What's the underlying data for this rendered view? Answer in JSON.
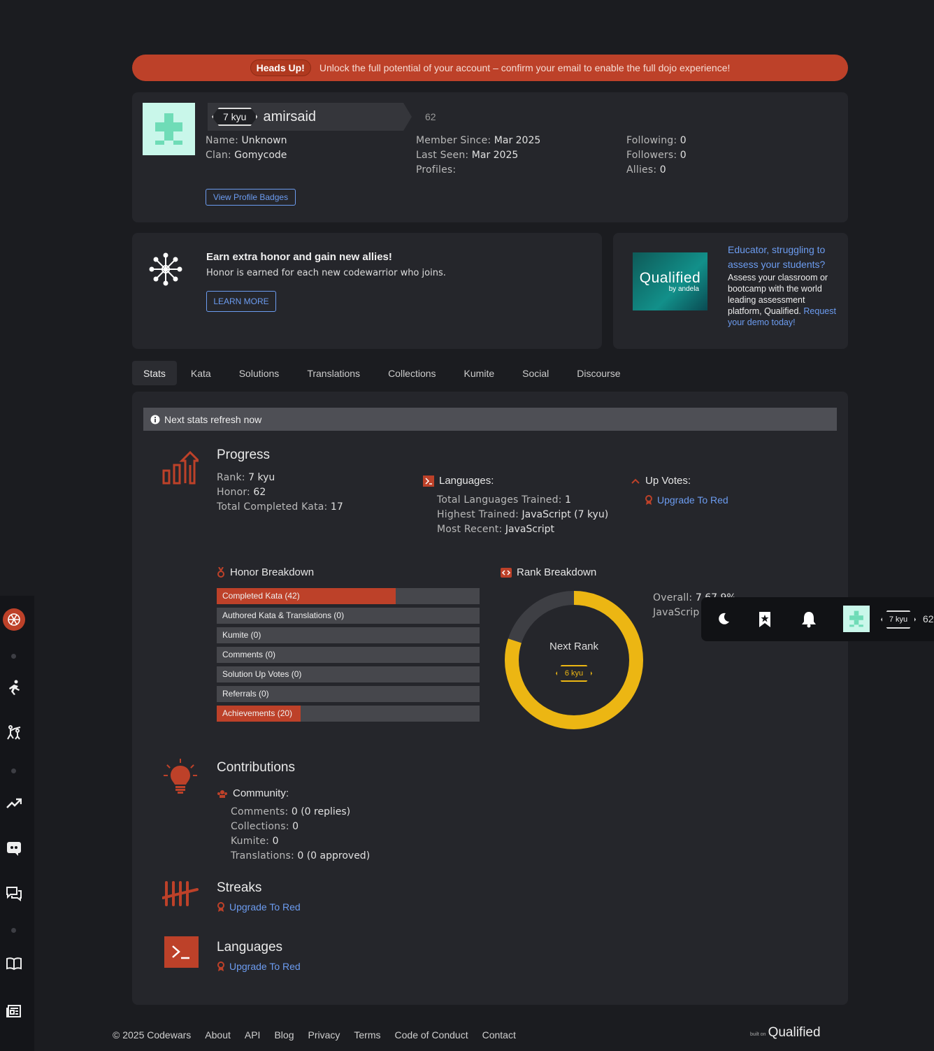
{
  "banner": {
    "pill": "Heads Up!",
    "message": "Unlock the full potential of your account – confirm your email to enable the full dojo experience!"
  },
  "profile": {
    "rank": "7 kyu",
    "username": "amirsaid",
    "honor": "62",
    "name_label": "Name:",
    "name": "Unknown",
    "clan_label": "Clan:",
    "clan": "Gomycode",
    "member_since_label": "Member Since:",
    "member_since": "Mar 2025",
    "last_seen_label": "Last Seen:",
    "last_seen": "Mar 2025",
    "profiles_label": "Profiles:",
    "following_label": "Following:",
    "following": "0",
    "followers_label": "Followers:",
    "followers": "0",
    "allies_label": "Allies:",
    "allies": "0",
    "badges_button": "View Profile Badges"
  },
  "promo": {
    "title": "Earn extra honor and gain new allies!",
    "text": "Honor is earned for each new codewarrior who joins.",
    "button": "LEARN MORE"
  },
  "qualified_ad": {
    "logo": "Qualified",
    "logo_sub": "by andela",
    "headline": "Educator, struggling to assess your students?",
    "body": "Assess your classroom or bootcamp with the world leading assessment platform, Qualified.",
    "cta": "Request your demo today!"
  },
  "tabs": [
    "Stats",
    "Kata",
    "Solutions",
    "Translations",
    "Collections",
    "Kumite",
    "Social",
    "Discourse"
  ],
  "notice": "Next stats refresh now",
  "progress": {
    "title": "Progress",
    "rank_label": "Rank:",
    "rank": "7 kyu",
    "honor_label": "Honor:",
    "honor": "62",
    "kata_label": "Total Completed Kata:",
    "kata": "17",
    "languages_title": "Languages:",
    "trained_label": "Total Languages Trained:",
    "trained": "1",
    "highest_label": "Highest Trained:",
    "highest": "JavaScript (7 kyu)",
    "recent_label": "Most Recent:",
    "recent": "JavaScript",
    "upvotes_title": "Up Votes:",
    "upgrade": "Upgrade To Red"
  },
  "honor_breakdown": {
    "title": "Honor Breakdown",
    "bars": [
      {
        "label": "Completed Kata (42)",
        "fill": 0.68
      },
      {
        "label": "Authored Kata & Translations (0)",
        "fill": 0
      },
      {
        "label": "Kumite (0)",
        "fill": 0
      },
      {
        "label": "Comments (0)",
        "fill": 0
      },
      {
        "label": "Solution Up Votes (0)",
        "fill": 0
      },
      {
        "label": "Referrals (0)",
        "fill": 0
      },
      {
        "label": "Achievements (20)",
        "fill": 0.32
      }
    ]
  },
  "rank_breakdown": {
    "title": "Rank Breakdown",
    "center": "Next Rank",
    "next": "6 kyu",
    "progress": 0.8,
    "overall_label": "Overall:",
    "overall_value": "7",
    "overall_tail": "67.9%",
    "js_label": "JavaScrip"
  },
  "contributions": {
    "title": "Contributions",
    "community": "Community:",
    "comments_label": "Comments:",
    "comments": "0 (0 replies)",
    "collections_label": "Collections:",
    "collections": "0",
    "kumite_label": "Kumite:",
    "kumite": "0",
    "translations_label": "Translations:",
    "translations": "0 (0 approved)"
  },
  "streaks": {
    "title": "Streaks",
    "upgrade": "Upgrade To Red"
  },
  "languages": {
    "title": "Languages",
    "upgrade": "Upgrade To Red"
  },
  "floatbar": {
    "rank": "7 kyu",
    "honor": "62"
  },
  "footer": {
    "copyright": "© 2025 Codewars",
    "links": [
      "About",
      "API",
      "Blog",
      "Privacy",
      "Terms",
      "Code of Conduct",
      "Contact"
    ],
    "built_on": "built on",
    "logo": "Qualified"
  },
  "colors": {
    "accent": "#bd4129",
    "link": "#6c9cf0",
    "rank_yellow": "#ecb613",
    "avatar": "#c9f7ea"
  }
}
